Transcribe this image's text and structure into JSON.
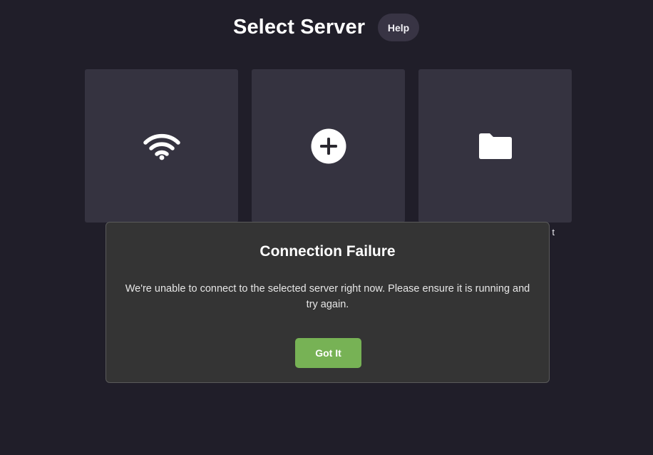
{
  "header": {
    "title": "Select Server",
    "help_label": "Help"
  },
  "tiles": [
    {
      "icon": "wifi-icon",
      "label": ""
    },
    {
      "icon": "plus-circle-icon",
      "label": ""
    },
    {
      "icon": "folder-icon",
      "label": "t"
    }
  ],
  "dialog": {
    "title": "Connection Failure",
    "message": "We're unable to connect to the selected server right now. Please ensure it is running and try again.",
    "button_label": "Got It"
  },
  "colors": {
    "background": "#201e29",
    "tile": "#353340",
    "help_button": "#383444",
    "dialog": "#343434",
    "primary_button": "#77b255"
  }
}
